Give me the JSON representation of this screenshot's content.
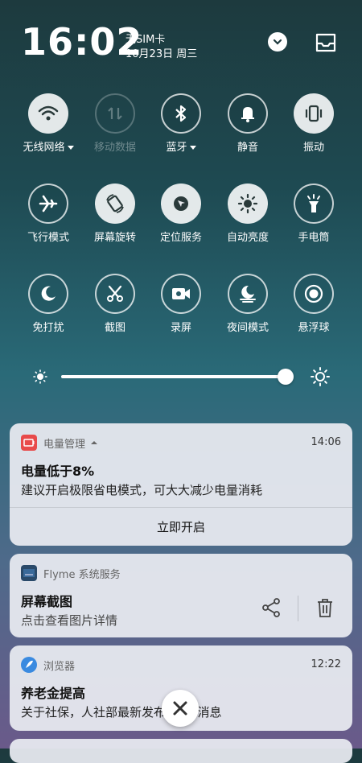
{
  "status": {
    "time": "16:02",
    "sim": "无SIM卡",
    "date": "10月23日 周三"
  },
  "toggles": {
    "row1": [
      {
        "label": "无线网络",
        "icon": "wifi-icon",
        "state": "on"
      },
      {
        "label": "移动数据",
        "icon": "mobile-data-icon",
        "state": "disabled"
      },
      {
        "label": "蓝牙",
        "icon": "bluetooth-icon",
        "state": "off"
      },
      {
        "label": "静音",
        "icon": "bell-icon",
        "state": "off"
      },
      {
        "label": "振动",
        "icon": "vibrate-icon",
        "state": "on"
      }
    ],
    "row2": [
      {
        "label": "飞行模式",
        "icon": "airplane-icon",
        "state": "off"
      },
      {
        "label": "屏幕旋转",
        "icon": "rotate-icon",
        "state": "on"
      },
      {
        "label": "定位服务",
        "icon": "location-icon",
        "state": "on"
      },
      {
        "label": "自动亮度",
        "icon": "brightness-icon",
        "state": "on"
      },
      {
        "label": "手电筒",
        "icon": "flashlight-icon",
        "state": "off"
      }
    ],
    "row3": [
      {
        "label": "免打扰",
        "icon": "moon-icon",
        "state": "off"
      },
      {
        "label": "截图",
        "icon": "scissors-icon",
        "state": "off"
      },
      {
        "label": "录屏",
        "icon": "screen-record-icon",
        "state": "off"
      },
      {
        "label": "夜间模式",
        "icon": "night-mode-icon",
        "state": "off"
      },
      {
        "label": "悬浮球",
        "icon": "floating-ball-icon",
        "state": "off"
      }
    ]
  },
  "brightness": {
    "level": 0.97
  },
  "notifications": [
    {
      "app": "电量管理",
      "time": "14:06",
      "title": "电量低于8%",
      "body": "建议开启极限省电模式，可大大减少电量消耗",
      "action": "立即开启",
      "accent": "#e84a4a"
    },
    {
      "app": "Flyme 系统服务",
      "title": "屏幕截图",
      "body": "点击查看图片详情"
    },
    {
      "app": "浏览器",
      "time": "12:22",
      "title": "养老金提高",
      "body": "关于社保，人社部最新发布5个好消息",
      "accent": "#3a8ae0"
    }
  ]
}
